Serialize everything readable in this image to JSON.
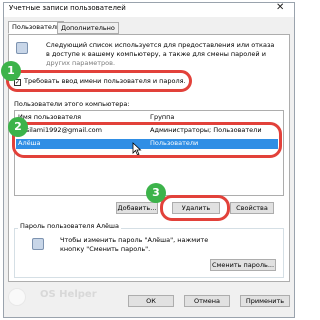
{
  "window": {
    "title": "Учетные записи пользователей",
    "close_glyph": "✕"
  },
  "tabs": [
    {
      "label": "Пользователи",
      "active": true
    },
    {
      "label": "Дополнительно",
      "active": false
    }
  ],
  "intro_text": {
    "line1": "Следующий список используется для предоставления или отказа",
    "line2": "в доступе к вашему компьютеру, а также для смены паролей и",
    "line3": "других параметров."
  },
  "require_login": {
    "label": "Требовать ввод имени пользователя и пароля.",
    "checked": true,
    "check_glyph": "✓"
  },
  "users_list": {
    "group_label": "Пользователи этого компьютера:",
    "columns": [
      "Имя пользователя",
      "Группа"
    ],
    "rows": [
      {
        "name": "vasilami1992@gmail.com",
        "group": "Администраторы; Пользователи"
      },
      {
        "name": "Алёша",
        "group": "Пользователи",
        "selected": true
      }
    ]
  },
  "buttons": {
    "add": "Добавить...",
    "remove": "Удалить",
    "properties": "Свойства",
    "change_password": "Сменить пароль...",
    "ok": "ОК",
    "cancel": "Отмена",
    "apply": "Применить"
  },
  "password_section": {
    "label": "Пароль пользователя Алёша",
    "line1": "Чтобы изменить пароль \"Алёша\", нажмите",
    "line2": "кнопку \"Сменить пароль\"."
  },
  "step_badges": [
    "1",
    "2",
    "3"
  ],
  "watermark": "OS Helper",
  "colors": {
    "highlight_oval": "#e2413a",
    "step_badge": "#3cb34a",
    "selection": "#2f8ee5"
  }
}
